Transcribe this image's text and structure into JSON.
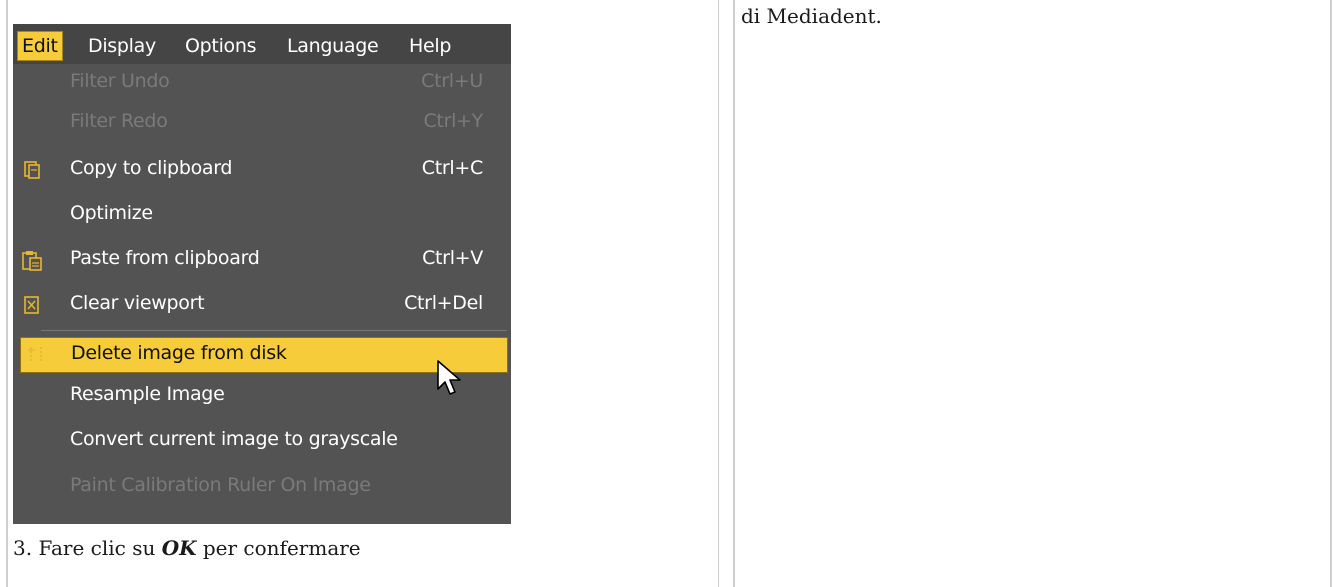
{
  "menubar": {
    "items": [
      "Edit",
      "Display",
      "Options",
      "Language",
      "Help"
    ],
    "active": "Edit"
  },
  "menu": {
    "items": [
      {
        "label": "Filter Undo",
        "shortcut": "Ctrl+U",
        "enabled": false,
        "icon": ""
      },
      {
        "label": "Filter Redo",
        "shortcut": "Ctrl+Y",
        "enabled": false,
        "icon": ""
      },
      {
        "label": "Copy to clipboard",
        "shortcut": "Ctrl+C",
        "enabled": true,
        "icon": "copy-icon"
      },
      {
        "label": "Optimize",
        "shortcut": "",
        "enabled": true,
        "icon": ""
      },
      {
        "label": "Paste from clipboard",
        "shortcut": "Ctrl+V",
        "enabled": true,
        "icon": "paste-icon"
      },
      {
        "label": "Clear viewport",
        "shortcut": "Ctrl+Del",
        "enabled": true,
        "icon": "clear-icon"
      },
      {
        "label": "Delete image from disk",
        "shortcut": "",
        "enabled": true,
        "highlighted": true,
        "icon": "delete-icon"
      },
      {
        "label": "Resample Image",
        "shortcut": "",
        "enabled": true,
        "icon": ""
      },
      {
        "label": "Convert current image to grayscale",
        "shortcut": "",
        "enabled": true,
        "icon": ""
      },
      {
        "label": "Paint Calibration Ruler On Image",
        "shortcut": "",
        "enabled": false,
        "icon": ""
      }
    ]
  },
  "caption": {
    "prefix": "3. Fare clic su ",
    "emphasis": "OK",
    "suffix": " per confermare"
  },
  "right_column": {
    "text": "di Mediadent."
  },
  "colors": {
    "menu_bg": "#535353",
    "highlight": "#f7cc3a"
  }
}
